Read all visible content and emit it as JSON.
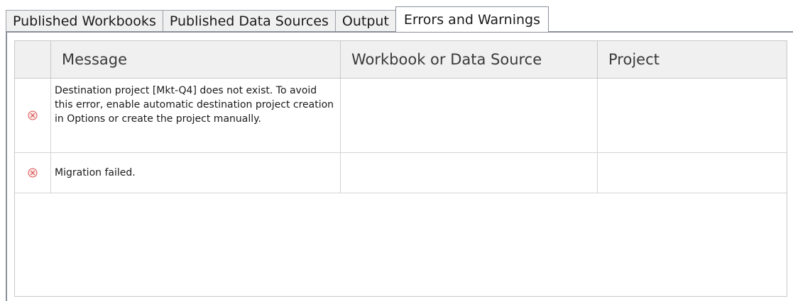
{
  "tabs": [
    {
      "label": "Published Workbooks",
      "active": false
    },
    {
      "label": "Published Data Sources",
      "active": false
    },
    {
      "label": "Output",
      "active": false
    },
    {
      "label": "Errors and Warnings",
      "active": true
    }
  ],
  "grid": {
    "columns": [
      "",
      "Message",
      "Workbook or Data Source",
      "Project"
    ],
    "rows": [
      {
        "icon": "error-circle-x-icon",
        "message": "Destination project [Mkt-Q4] does not exist. To avoid this error, enable automatic destination project creation in Options or create the project manually.",
        "workbook_or_data_source": "",
        "project": ""
      },
      {
        "icon": "error-circle-x-icon",
        "message": "Migration failed.",
        "workbook_or_data_source": "",
        "project": ""
      }
    ]
  },
  "colors": {
    "error_icon": "#d9534f",
    "header_bg": "#f0f0f0",
    "border": "#c8c8c8"
  }
}
